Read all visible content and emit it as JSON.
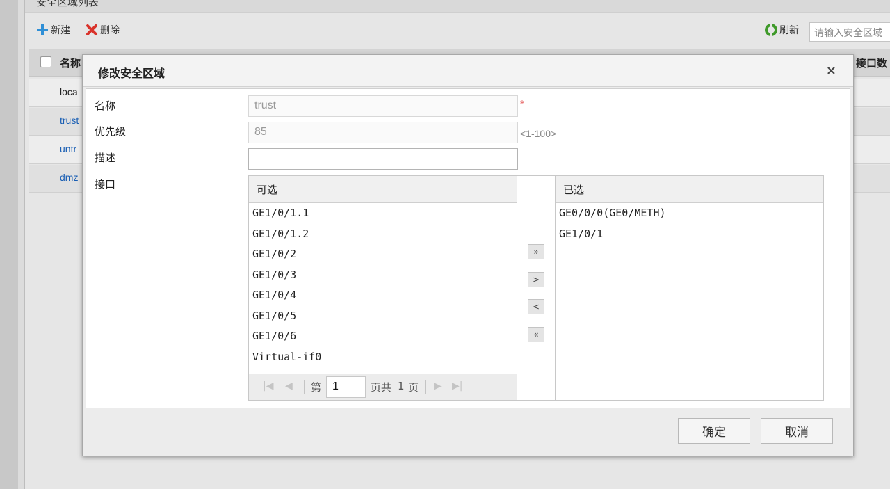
{
  "background": {
    "panel_title": "安全区域列表",
    "toolbar": {
      "new_label": "新建",
      "delete_label": "删除",
      "refresh_label": "刷新",
      "search_placeholder": "请输入安全区域"
    },
    "grid": {
      "col_name": "名称",
      "col_interface_count": "接口数",
      "rows": [
        "loca",
        "trust",
        "untr",
        "dmz"
      ]
    }
  },
  "dialog": {
    "title": "修改安全区域",
    "close_symbol": "×",
    "fields": {
      "name_label": "名称",
      "name_value": "trust",
      "required_mark": "*",
      "priority_label": "优先级",
      "priority_value": "85",
      "priority_hint": "<1-100>",
      "desc_label": "描述",
      "desc_value": "",
      "interface_label": "接口"
    },
    "available": {
      "header": "可选",
      "items": [
        "GE1/0/1.1",
        "GE1/0/1.2",
        "GE1/0/2",
        "GE1/0/3",
        "GE1/0/4",
        "GE1/0/5",
        "GE1/0/6",
        "Virtual-if0"
      ]
    },
    "pager": {
      "prefix": "第",
      "page": "1",
      "suffix": "页共",
      "total": "1",
      "unit": "页"
    },
    "move_buttons": {
      "add_all": "»",
      "add": ">",
      "remove": "<",
      "remove_all": "«"
    },
    "selected": {
      "header": "已选",
      "items": [
        "GE0/0/0(GE0/METH)",
        "GE1/0/1"
      ]
    },
    "ok_label": "确定",
    "cancel_label": "取消"
  },
  "colors": {
    "link_blue": "#1a5fb4",
    "add_green_blue": "#2f8fd6",
    "delete_red": "#d9332b",
    "refresh_green": "#3f9a2a"
  }
}
